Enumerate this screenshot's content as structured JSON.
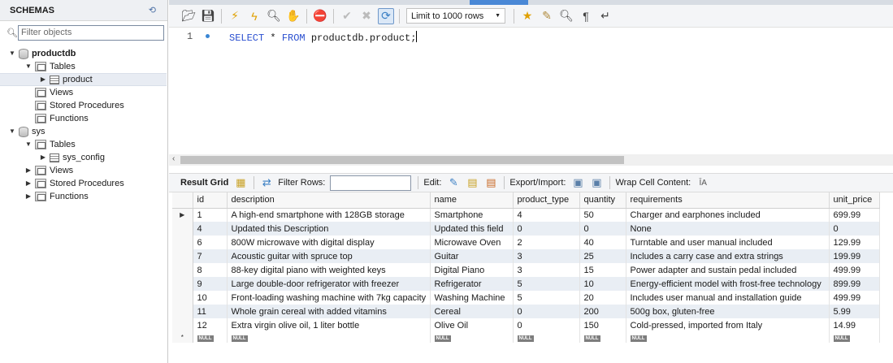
{
  "sidebar": {
    "title": "SCHEMAS",
    "filter_placeholder": "Filter objects",
    "tree": {
      "db1": "productdb",
      "db1_tables": "Tables",
      "db1_table1": "product",
      "db1_views": "Views",
      "db1_procs": "Stored Procedures",
      "db1_funcs": "Functions",
      "db2": "sys",
      "db2_tables": "Tables",
      "db2_table1": "sys_config",
      "db2_views": "Views",
      "db2_procs": "Stored Procedures",
      "db2_funcs": "Functions"
    }
  },
  "toolbar": {
    "limit_label": "Limit to 1000 rows"
  },
  "editor": {
    "line_number": "1",
    "kw_select": "SELECT",
    "star": " * ",
    "kw_from": "FROM",
    "rest": " productdb.product;"
  },
  "result_toolbar": {
    "result_grid": "Result Grid",
    "filter_rows": "Filter Rows:",
    "edit": "Edit:",
    "export_import": "Export/Import:",
    "wrap": "Wrap Cell Content:"
  },
  "grid": {
    "columns": [
      "id",
      "description",
      "name",
      "product_type",
      "quantity",
      "requirements",
      "unit_price"
    ],
    "rows": [
      [
        "1",
        "A high-end smartphone with 128GB storage",
        "Smartphone",
        "4",
        "50",
        "Charger and earphones included",
        "699.99"
      ],
      [
        "4",
        "Updated this Description",
        "Updated this field",
        "0",
        "0",
        "None",
        "0"
      ],
      [
        "6",
        "800W microwave with digital display",
        "Microwave Oven",
        "2",
        "40",
        "Turntable and user manual included",
        "129.99"
      ],
      [
        "7",
        "Acoustic guitar with spruce top",
        "Guitar",
        "3",
        "25",
        "Includes a carry case and extra strings",
        "199.99"
      ],
      [
        "8",
        "88-key digital piano with weighted keys",
        "Digital Piano",
        "3",
        "15",
        "Power adapter and sustain pedal included",
        "499.99"
      ],
      [
        "9",
        "Large double-door refrigerator with freezer",
        "Refrigerator",
        "5",
        "10",
        "Energy-efficient model with frost-free technology",
        "899.99"
      ],
      [
        "10",
        "Front-loading washing machine with 7kg capacity",
        "Washing Machine",
        "5",
        "20",
        "Includes user manual and installation guide",
        "499.99"
      ],
      [
        "11",
        "Whole grain cereal with added vitamins",
        "Cereal",
        "0",
        "200",
        "500g box, gluten-free",
        "5.99"
      ],
      [
        "12",
        "Extra virgin olive oil, 1 liter bottle",
        "Olive Oil",
        "0",
        "150",
        "Cold-pressed, imported from Italy",
        "14.99"
      ]
    ],
    "null_label": "NULL",
    "current_row_marker": "▶",
    "new_row_marker": "*"
  }
}
